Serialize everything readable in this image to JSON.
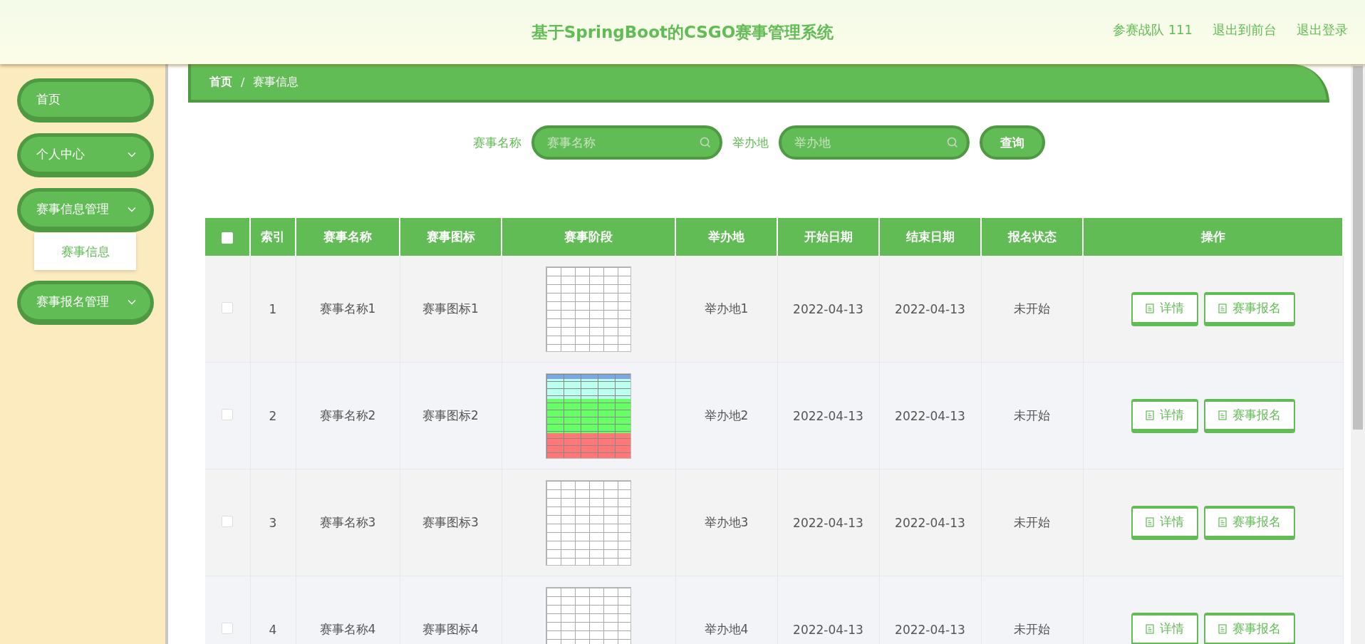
{
  "header": {
    "title": "基于SpringBoot的CSGO赛事管理系统",
    "links": [
      "参赛战队 111",
      "退出到前台",
      "退出登录"
    ]
  },
  "sidebar": {
    "items": [
      {
        "label": "首页",
        "has_children": false
      },
      {
        "label": "个人中心",
        "has_children": true
      },
      {
        "label": "赛事信息管理",
        "has_children": true,
        "children": [
          {
            "label": "赛事信息",
            "selected": true
          }
        ]
      },
      {
        "label": "赛事报名管理",
        "has_children": true
      }
    ]
  },
  "breadcrumb": [
    "首页",
    "赛事信息"
  ],
  "breadcrumb_separator": "/",
  "search": {
    "fields": [
      {
        "label": "赛事名称",
        "placeholder": "赛事名称"
      },
      {
        "label": "举办地",
        "placeholder": "举办地"
      }
    ],
    "button": "查询"
  },
  "table": {
    "select_all_checked": false,
    "columns": [
      "索引",
      "赛事名称",
      "赛事图标",
      "赛事阶段",
      "举办地",
      "开始日期",
      "结束日期",
      "报名状态",
      "操作"
    ],
    "rows": [
      {
        "selected": false,
        "index": "1",
        "name": "赛事名称1",
        "icon": "赛事图标1",
        "kind": "plain",
        "venue": "举办地1",
        "start": "2022-04-13",
        "end": "2022-04-13",
        "status": "未开始",
        "actions": [
          "详情",
          "赛事报名"
        ]
      },
      {
        "selected": false,
        "index": "2",
        "name": "赛事名称2",
        "icon": "赛事图标2",
        "kind": "colored",
        "venue": "举办地2",
        "start": "2022-04-13",
        "end": "2022-04-13",
        "status": "未开始",
        "actions": [
          "详情",
          "赛事报名"
        ]
      },
      {
        "selected": false,
        "index": "3",
        "name": "赛事名称3",
        "icon": "赛事图标3",
        "kind": "plain",
        "venue": "举办地3",
        "start": "2022-04-13",
        "end": "2022-04-13",
        "status": "未开始",
        "actions": [
          "详情",
          "赛事报名"
        ]
      },
      {
        "selected": false,
        "index": "4",
        "name": "赛事名称4",
        "icon": "赛事图标4",
        "kind": "plain",
        "venue": "举办地4",
        "start": "2022-04-13",
        "end": "2022-04-13",
        "status": "未开始",
        "actions": [
          "详情",
          "赛事报名"
        ]
      }
    ]
  }
}
